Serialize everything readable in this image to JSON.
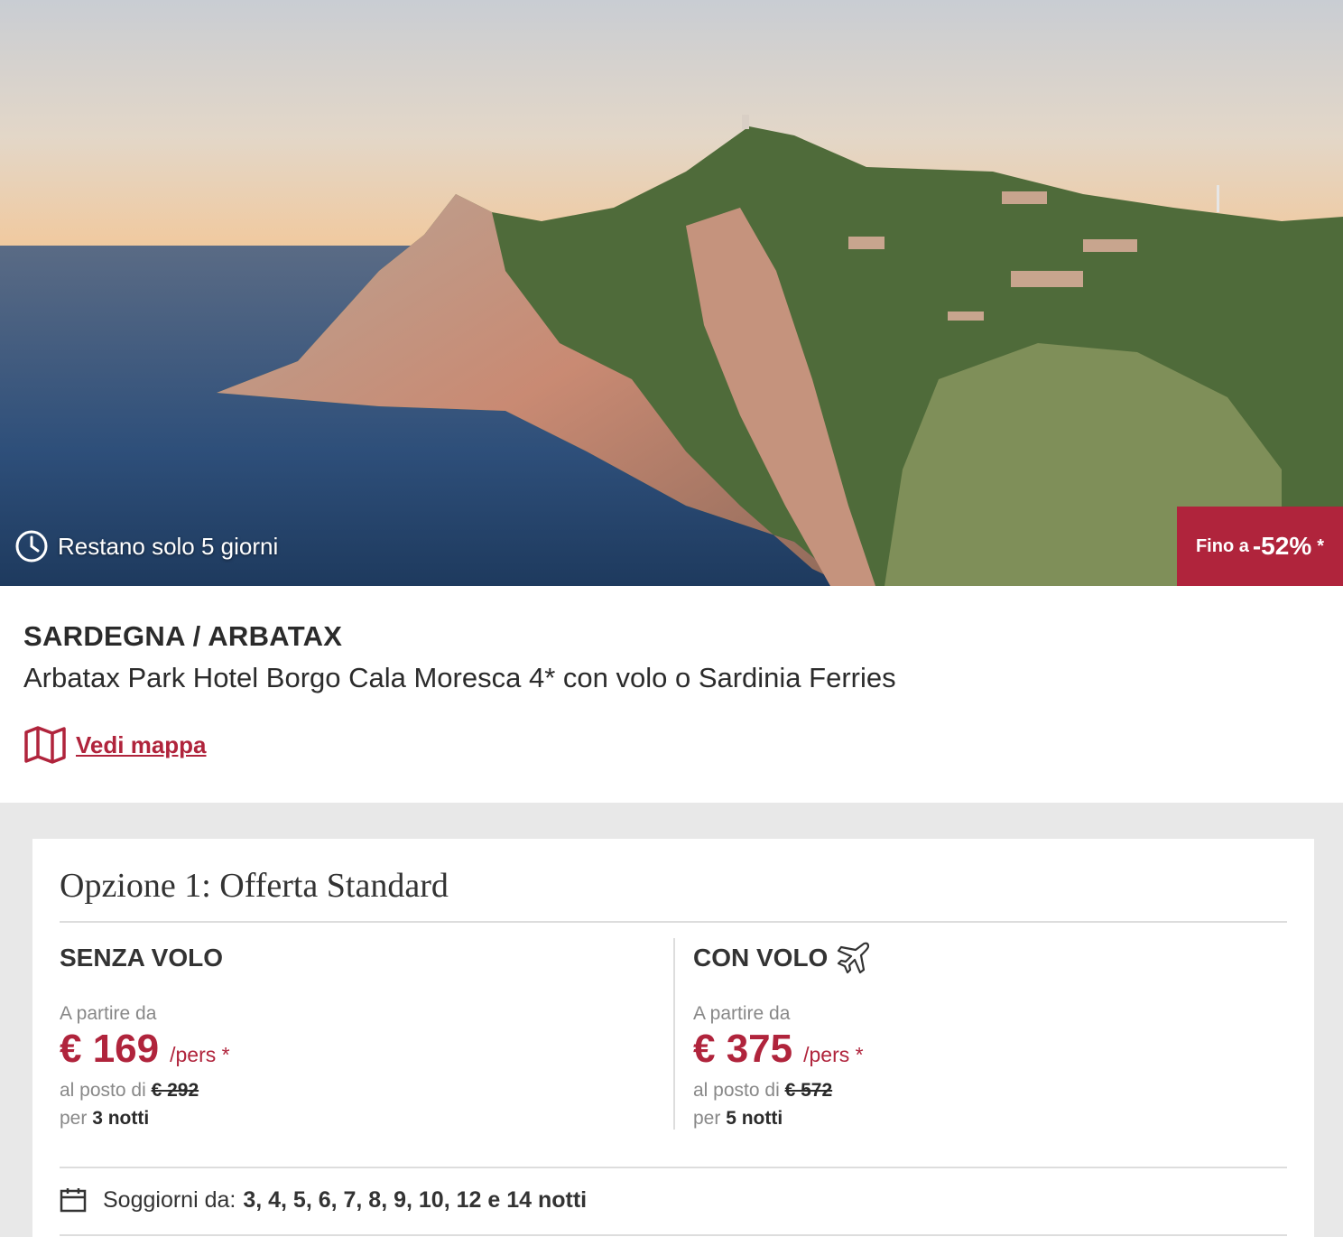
{
  "colors": {
    "accent": "#b0243c",
    "card_bg": "#ffffff",
    "page_bg": "#e8e8e8"
  },
  "hero": {
    "countdown_text": "Restano solo 5 giorni",
    "countdown_icon": "clock-icon",
    "discount_prefix": "Fino a",
    "discount_value": "-52%",
    "discount_suffix": "*"
  },
  "listing": {
    "region": "SARDEGNA / ARBATAX",
    "hotel_name": "Arbatax Park Hotel Borgo Cala Moresca 4* con volo o Sardinia Ferries",
    "map_link_label": "Vedi mappa",
    "map_icon": "map-icon"
  },
  "offer": {
    "title": "Opzione 1: Offerta Standard",
    "without_flight": {
      "heading": "SENZA VOLO",
      "from_label": "A partire da",
      "price": "€ 169",
      "per_label": "/pers *",
      "instead_label": "al posto di",
      "original_price": "€ 292",
      "nights_prefix": "per",
      "nights": "3 notti"
    },
    "with_flight": {
      "heading": "CON VOLO",
      "heading_icon": "plane-icon",
      "from_label": "A partire da",
      "price": "€ 375",
      "per_label": "/pers *",
      "instead_label": "al posto di",
      "original_price": "€ 572",
      "nights_prefix": "per",
      "nights": "5 notti"
    },
    "stays_label": "Soggiorni da:",
    "stays_values": "3, 4, 5, 6, 7, 8, 9, 10, 12 e 14 notti",
    "stays_icon": "calendar-icon"
  }
}
